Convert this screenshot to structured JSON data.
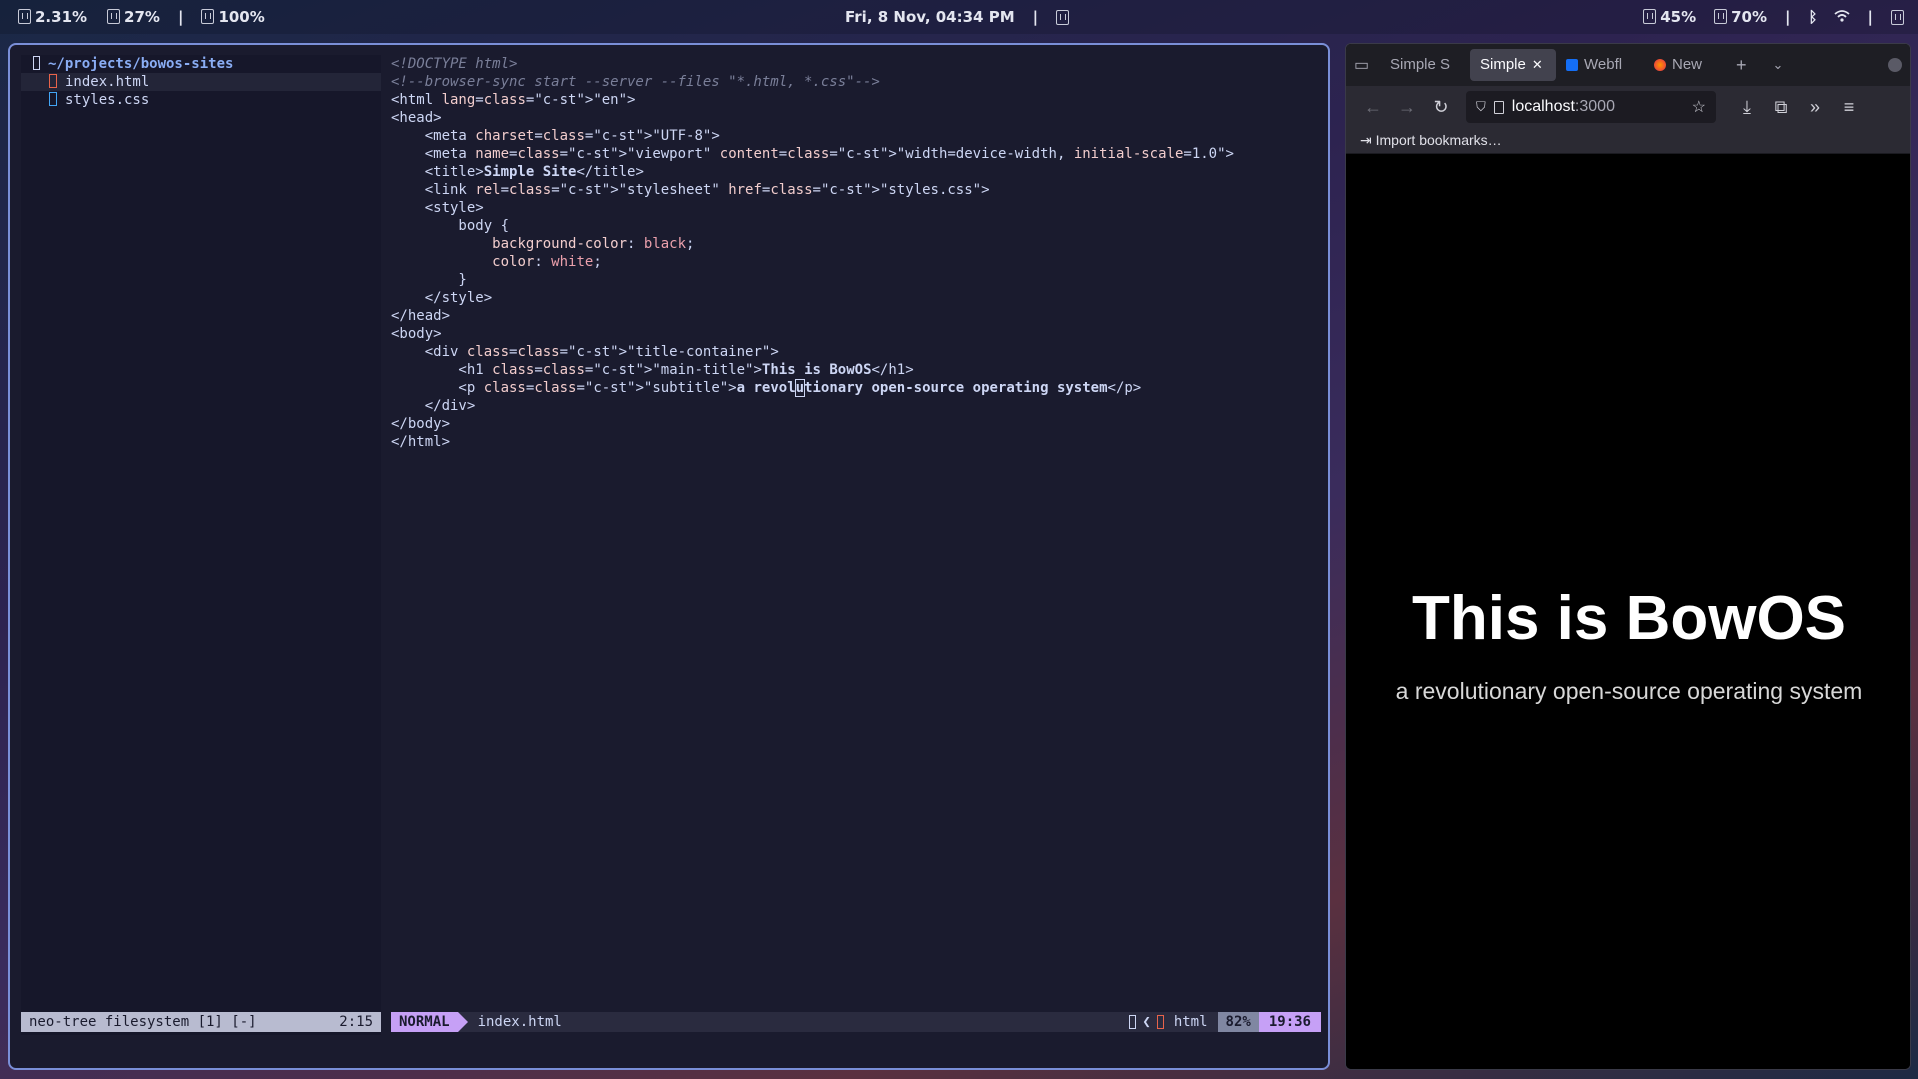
{
  "topbar": {
    "cpu": "2.31%",
    "mem": "27%",
    "disk": "100%",
    "sep": "|",
    "datetime": "Fri,  8 Nov, 04:34 PM",
    "vol": "45%",
    "bright": "70%"
  },
  "tree": {
    "root": "~/projects/bowos-sites",
    "files": [
      "index.html",
      "styles.css"
    ]
  },
  "code": [
    "<!DOCTYPE html>",
    "<!--browser-sync start --server --files \"*.html, *.css\"-->",
    "<html lang=\"en\">",
    "<head>",
    "    <meta charset=\"UTF-8\">",
    "    <meta name=\"viewport\" content=\"width=device-width, initial-scale=1.0\">",
    "    <title>Simple Site</title>",
    "    <link rel=\"stylesheet\" href=\"styles.css\">",
    "    <style>",
    "        body {",
    "            background-color: black;",
    "            color: white;",
    "        }",
    "    </style>",
    "</head>",
    "<body>",
    "    <div class=\"title-container\">",
    "        <h1 class=\"main-title\">This is BowOS</h1>",
    "        <p class=\"subtitle\">a revolutionary open-source operating system</p>",
    "    </div>",
    "</body>",
    "</html>"
  ],
  "status": {
    "tree_label": "neo-tree filesystem [1] [-]",
    "tree_pos": "2:15",
    "mode": "NORMAL",
    "filename": "index.html",
    "filetype": "html",
    "percent": "82%",
    "position": "19:36"
  },
  "browser": {
    "tabs": [
      "Simple S",
      "Simple",
      "Webfl",
      "New"
    ],
    "url_host": "localhost",
    "url_port": ":3000",
    "bookmarks_label": "Import bookmarks…",
    "heading": "This is BowOS",
    "subtitle": "a revolutionary open-source operating system"
  }
}
